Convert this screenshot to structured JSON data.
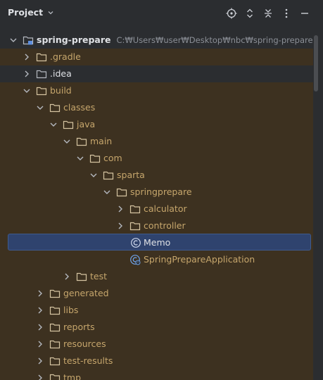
{
  "header": {
    "title": "Project",
    "actions": [
      "locate-icon",
      "expand-all-icon",
      "collapse-all-icon",
      "options-icon",
      "hide-icon"
    ]
  },
  "colors": {
    "folder": "#d5c4a1",
    "selection": "#2f436e",
    "excluded_bg": "#3d3120",
    "class_icon": "#6fa3ea"
  },
  "tree": {
    "root_label": "spring-prepare",
    "root_path": "C:₩Users₩user₩Desktop₩nbc₩spring-prepare",
    "gradle": ".gradle",
    "idea": ".idea",
    "build": "build",
    "classes": "classes",
    "java": "java",
    "main": "main",
    "com": "com",
    "sparta": "sparta",
    "springprepare": "springprepare",
    "calculator": "calculator",
    "controller": "controller",
    "memo": "Memo",
    "app": "SpringPrepareApplication",
    "test": "test",
    "generated": "generated",
    "libs": "libs",
    "reports": "reports",
    "resources": "resources",
    "test_results": "test-results",
    "tmp": "tmp"
  }
}
